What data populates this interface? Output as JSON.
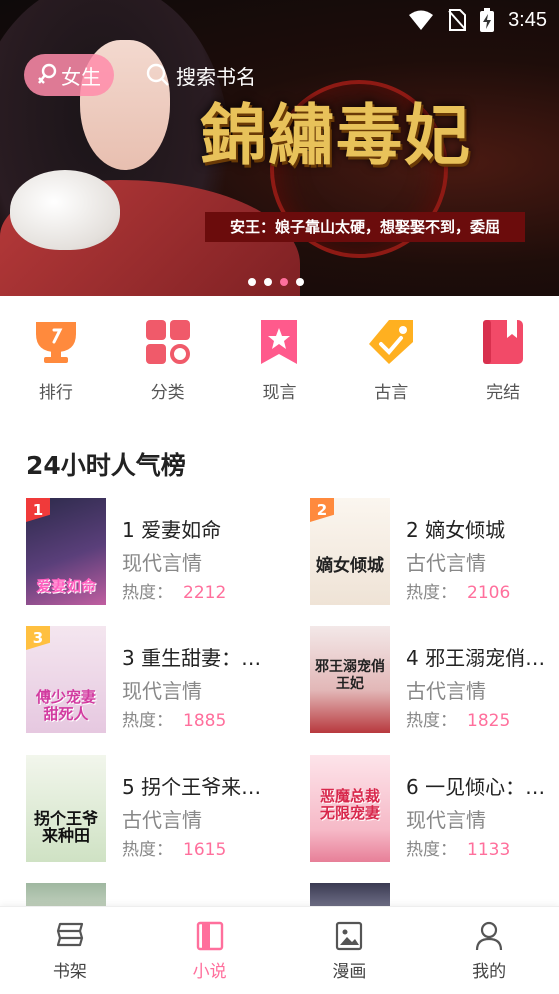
{
  "status": {
    "time": "3:45"
  },
  "banner": {
    "title": "錦繡毒妃",
    "tagline": "安王：娘子靠山太硬，想娶娶不到，委屈",
    "dots": 4,
    "active_dot": 3
  },
  "header": {
    "gender_label": "女生",
    "search_placeholder": "搜索书名"
  },
  "categories": [
    {
      "label": "排行",
      "icon": "trophy-icon",
      "color": "#ff8a3d"
    },
    {
      "label": "分类",
      "icon": "grid-icon",
      "color": "#f05a6a"
    },
    {
      "label": "现言",
      "icon": "star-bookmark-icon",
      "color": "#ff5a8c"
    },
    {
      "label": "古言",
      "icon": "tag-icon",
      "color": "#ffb020"
    },
    {
      "label": "完结",
      "icon": "book-icon",
      "color": "#f24a68"
    }
  ],
  "section_title": "24小时人气榜",
  "books": [
    {
      "rank": "1",
      "name": "1 爱妻如命",
      "category": "现代言情",
      "heat_label": "热度：",
      "heat": "2212",
      "cover_text": "爱妻如命",
      "rank_color": "#f03a3a"
    },
    {
      "rank": "2",
      "name": "2 嫡女倾城",
      "category": "古代言情",
      "heat_label": "热度：",
      "heat": "2106",
      "cover_text": "嫡女倾城",
      "rank_color": "#ff8a3d"
    },
    {
      "rank": "3",
      "name": "3 重生甜妻：…",
      "category": "现代言情",
      "heat_label": "热度：",
      "heat": "1885",
      "cover_text": "傅少宠妻甜死人",
      "rank_color": "#ffc040"
    },
    {
      "rank": "",
      "name": "4 邪王溺宠俏…",
      "category": "古代言情",
      "heat_label": "热度：",
      "heat": "1825",
      "cover_text": "邪王溺宠俏王妃",
      "rank_color": ""
    },
    {
      "rank": "",
      "name": "5 拐个王爷来…",
      "category": "古代言情",
      "heat_label": "热度：",
      "heat": "1615",
      "cover_text": "拐个王爷来种田",
      "rank_color": ""
    },
    {
      "rank": "",
      "name": "6 一见倾心：…",
      "category": "现代言情",
      "heat_label": "热度：",
      "heat": "1133",
      "cover_text": "恶魔总裁无限宠妻",
      "rank_color": ""
    }
  ],
  "tabs": [
    {
      "label": "书架",
      "icon": "bookshelf-icon",
      "active": false
    },
    {
      "label": "小说",
      "icon": "novel-icon",
      "active": true
    },
    {
      "label": "漫画",
      "icon": "comic-icon",
      "active": false
    },
    {
      "label": "我的",
      "icon": "profile-icon",
      "active": false
    }
  ],
  "colors": {
    "accent": "#ff6f9c",
    "heat": "#ff6f9c"
  }
}
